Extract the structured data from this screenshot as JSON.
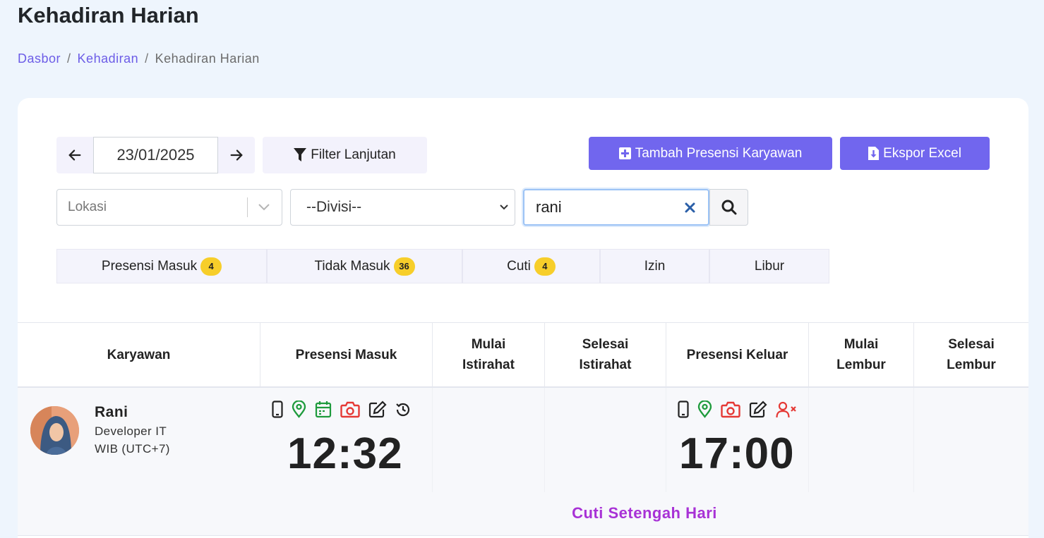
{
  "page": {
    "title": "Kehadiran Harian",
    "breadcrumb": [
      "Dasbor",
      "Kehadiran",
      "Kehadiran Harian"
    ],
    "accent": "#7166ee"
  },
  "toolbar": {
    "date": "23/01/2025",
    "prev_icon": "arrow-left-icon",
    "next_icon": "arrow-right-icon",
    "filter_label": "Filter Lanjutan",
    "add_label": "Tambah Presensi Karyawan",
    "export_label": "Ekspor Excel"
  },
  "filters": {
    "lokasi_placeholder": "Lokasi",
    "divisi_value": "--Divisi--",
    "search_value": "rani"
  },
  "tabs": [
    {
      "label": "Presensi Masuk",
      "count": "4"
    },
    {
      "label": "Tidak Masuk",
      "count": "36"
    },
    {
      "label": "Cuti",
      "count": "4"
    },
    {
      "label": "Izin",
      "count": ""
    },
    {
      "label": "Libur",
      "count": ""
    }
  ],
  "table": {
    "columns": [
      {
        "line1": "Karyawan",
        "line2": ""
      },
      {
        "line1": "Presensi Masuk",
        "line2": ""
      },
      {
        "line1": "Mulai",
        "line2": "Istirahat"
      },
      {
        "line1": "Selesai",
        "line2": "Istirahat"
      },
      {
        "line1": "Presensi Keluar",
        "line2": ""
      },
      {
        "line1": "Mulai",
        "line2": "Lembur"
      },
      {
        "line1": "Selesai",
        "line2": "Lembur"
      }
    ],
    "rows": [
      {
        "name": "Rani",
        "role": "Developer IT",
        "timezone": "WIB (UTC+7)",
        "check_in": "12:32",
        "check_out": "17:00",
        "note": "Cuti Setengah Hari"
      }
    ]
  },
  "colors": {
    "green_icon": "#1e9b3c",
    "red_icon": "#e53935",
    "note": "#a832d6",
    "badge": "#f7ce2a"
  }
}
